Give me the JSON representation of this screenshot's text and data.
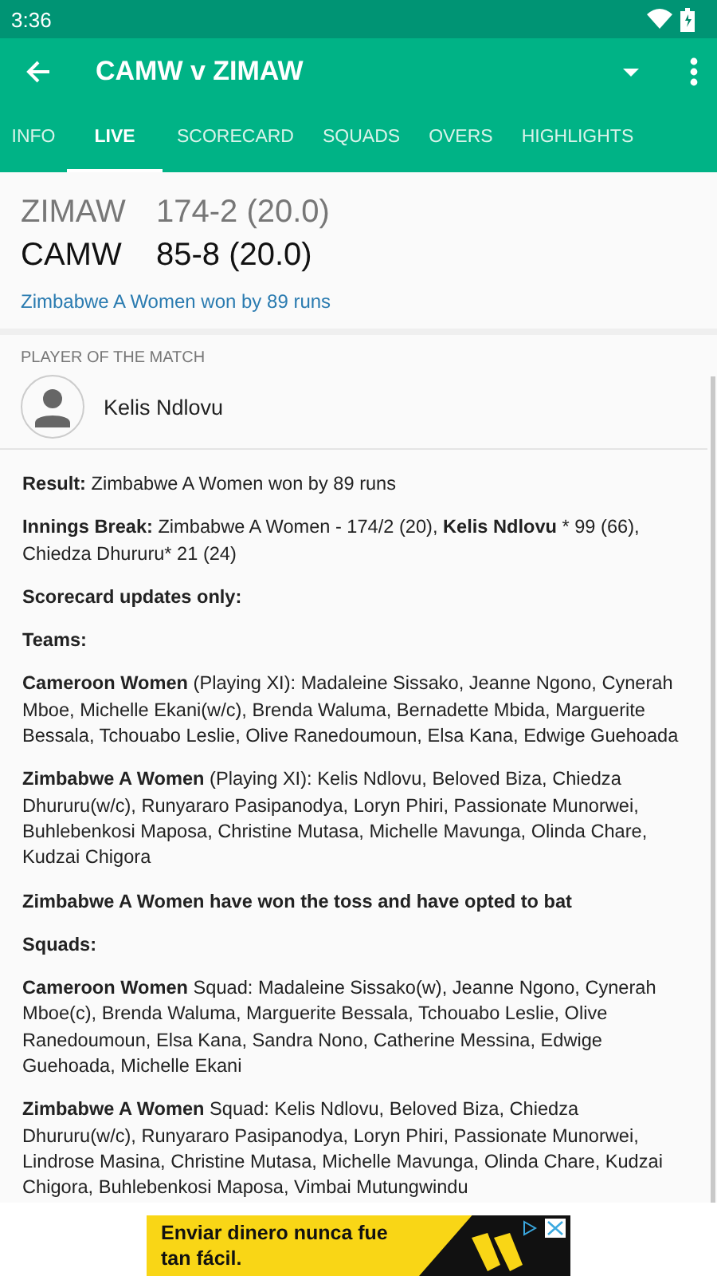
{
  "status_bar": {
    "time": "3:36"
  },
  "app_bar": {
    "title": "CAMW v ZIMAW"
  },
  "tabs": [
    {
      "label": "INFO",
      "selected": false
    },
    {
      "label": "LIVE",
      "selected": true
    },
    {
      "label": "SCORECARD",
      "selected": false
    },
    {
      "label": "SQUADS",
      "selected": false
    },
    {
      "label": "OVERS",
      "selected": false
    },
    {
      "label": "HIGHLIGHTS",
      "selected": false
    }
  ],
  "scores": [
    {
      "team": "ZIMAW",
      "score": "174-2 (20.0)",
      "batting": false
    },
    {
      "team": "CAMW",
      "score": "85-8 (20.0)",
      "batting": true
    }
  ],
  "result": "Zimbabwe A Women won by 89 runs",
  "player_of_the_match": {
    "heading": "PLAYER OF THE MATCH",
    "name": "Kelis Ndlovu"
  },
  "commentary": [
    {
      "kind": "text",
      "text": "**Result:** Zimbabwe A Women won by 89 runs"
    },
    {
      "kind": "text",
      "text": "**Innings Break:** Zimbabwe A Women - 174/2 (20), **Kelis Ndlovu** * 99 (66), Chiedza Dhururu* 21 (24)"
    },
    {
      "kind": "heading",
      "text": "Scorecard updates only:"
    },
    {
      "kind": "heading",
      "text": "Teams:"
    },
    {
      "kind": "text",
      "text": "**Cameroon Women** (Playing XI): Madaleine Sissako, Jeanne Ngono, Cynerah Mboe, Michelle Ekani(w/c), Brenda Waluma, Bernadette Mbida, Marguerite Bessala, Tchouabo Leslie, Olive Ranedoumoun, Elsa Kana, Edwige Guehoada"
    },
    {
      "kind": "text",
      "text": "**Zimbabwe A Women** (Playing XI): Kelis Ndlovu, Beloved Biza, Chiedza Dhururu(w/c), Runyararo Pasipanodya, Loryn Phiri, Passionate Munorwei, Buhlebenkosi Maposa, Christine Mutasa, Michelle Mavunga, Olinda Chare, Kudzai Chigora"
    },
    {
      "kind": "heading",
      "text": "Zimbabwe A Women have won the toss and have opted to bat"
    },
    {
      "kind": "heading",
      "text": "Squads:"
    },
    {
      "kind": "text",
      "text": "**Cameroon Women** Squad: Madaleine Sissako(w), Jeanne Ngono, Cynerah Mboe(c), Brenda Waluma, Marguerite Bessala, Tchouabo Leslie, Olive Ranedoumoun, Elsa Kana, Sandra Nono, Catherine Messina, Edwige Guehoada, Michelle Ekani"
    },
    {
      "kind": "text",
      "text": "**Zimbabwe A Women** Squad: Kelis Ndlovu, Beloved Biza, Chiedza Dhururu(w/c), Runyararo Pasipanodya, Loryn Phiri, Passionate Munorwei, Lindrose Masina, Christine Mutasa, Michelle Mavunga, Olinda Chare, Kudzai Chigora, Buhlebenkosi Maposa, Vimbai Mutungwindu"
    }
  ],
  "ad": {
    "text": "Enviar dinero nunca fue tan fácil."
  }
}
